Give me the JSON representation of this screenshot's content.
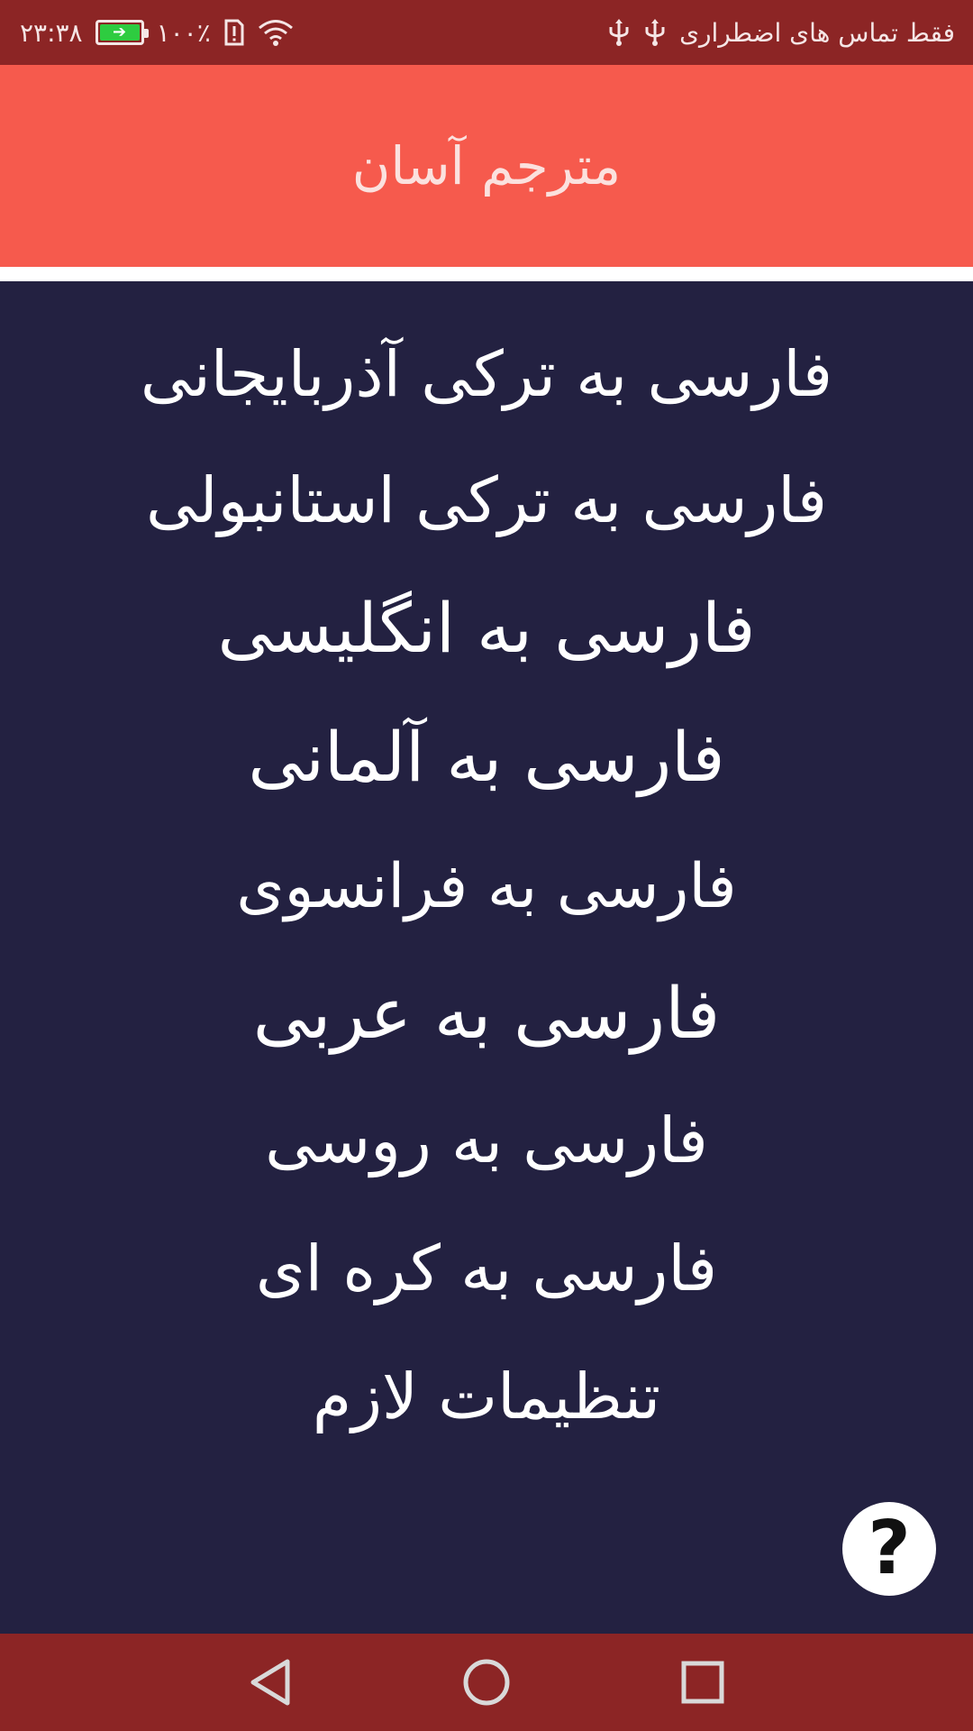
{
  "status_bar": {
    "carrier_text": "فقط تماس های اضطراری",
    "time": "۲۳:۳۸",
    "battery_percent": "۱۰۰٪",
    "battery_level": 1.0,
    "icons": [
      "usb-icon",
      "usb-icon",
      "sim-alert-icon",
      "wifi-icon",
      "battery-charging-icon"
    ]
  },
  "header": {
    "title": "مترجم آسان"
  },
  "menu": {
    "items": [
      {
        "label": "فارسی به ترکی آذربایجانی"
      },
      {
        "label": "فارسی به ترکی استانبولی"
      },
      {
        "label": "فارسی به انگلیسی"
      },
      {
        "label": "فارسی به آلمانی"
      },
      {
        "label": "فارسی به فرانسوی"
      },
      {
        "label": "فارسی به عربی"
      },
      {
        "label": "فارسی به روسی"
      },
      {
        "label": "فارسی به کره ای"
      },
      {
        "label": "تنظیمات لازم"
      }
    ]
  },
  "help_button": {
    "label": "?"
  },
  "nav_bar": {
    "icons": [
      "back-icon",
      "home-icon",
      "recents-icon"
    ]
  },
  "colors": {
    "status_bar": "#8c2525",
    "header": "#f65a4d",
    "background": "#232141",
    "menu_text": "#ffffff"
  }
}
